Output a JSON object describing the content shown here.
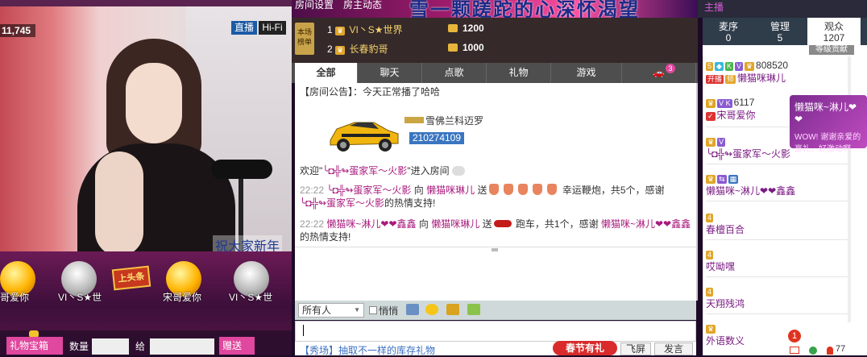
{
  "stream": {
    "viewer_count": "11,745",
    "btn_live": "直播",
    "btn_hifi": "Hi-Fi",
    "overlay_text": "祝大家新年"
  },
  "gift_row": {
    "items": [
      {
        "label": "哥爱你",
        "style": "gold"
      },
      {
        "label": "VI丶S★世",
        "style": "gray"
      },
      {
        "label": "宋哥爱你",
        "style": "gold"
      },
      {
        "label": "VI丶S★世",
        "style": "gray"
      }
    ],
    "headline_badge": "上头条"
  },
  "gift_bar": {
    "gift_box_label": "礼物宝箱",
    "qty_label": "数量",
    "give_label": "给",
    "send_label": "赠送"
  },
  "mid_top": {
    "links": [
      "房间设置",
      "房主动态"
    ],
    "banner": "雪一颗蹉跎的心深怀渴望"
  },
  "rank": {
    "badge": "本场榜单",
    "rows": [
      {
        "pos": "1",
        "name": "VI丶S★世界",
        "coins": "1200"
      },
      {
        "pos": "2",
        "name": "长春豹哥",
        "coins": "1000"
      }
    ]
  },
  "tabs": [
    {
      "label": "全部",
      "active": true
    },
    {
      "label": "聊天"
    },
    {
      "label": "点歌"
    },
    {
      "label": "礼物"
    },
    {
      "label": "游戏"
    }
  ],
  "car_badge_count": "3",
  "chat": {
    "notice_label": "【房间公告】：",
    "notice_text": "今天正常播了哈哈",
    "car_name": "雪佛兰科迈罗",
    "car_id": "210274109",
    "welcome_pre": "欢迎",
    "welcome_user": "╰◘╬↬蛋家军～火影",
    "welcome_post": "进入房间",
    "msg1": {
      "time": "22:22",
      "from": "╰◘╬↬蛋家军～火影",
      "to_word": "向",
      "to": "懒猫咪琳儿",
      "send": "送",
      "gift_text": "幸运鞭炮，共5个，感谢",
      "thank_user": "╰◘╬↬蛋家军～火影",
      "tail": "的热情支持!"
    },
    "msg2": {
      "time": "22:22",
      "from": "懒猫咪~淋儿❤❤鑫鑫",
      "to_word": "向",
      "to": "懒猫咪琳儿",
      "send": "送",
      "gift_text": "跑车，共1个，感谢",
      "thank_user": "懒猫咪~淋儿❤❤鑫鑫",
      "tail": "的热情支持!"
    }
  },
  "toolbar": {
    "recipient": "所有人",
    "quiet_label": "悄悄"
  },
  "promo": {
    "text": "【秀场】抽取不一样的库存礼物",
    "spring_btn": "春节有礼",
    "fly_btn": "飞屏",
    "send_btn": "发言"
  },
  "right": {
    "top_text": "主播",
    "tabs": [
      {
        "label": "麦序",
        "count": "0"
      },
      {
        "label": "管理",
        "count": "5"
      },
      {
        "label": "观众",
        "count": "1207",
        "active": true
      }
    ],
    "header_label": "等级贡献",
    "users": [
      {
        "badges": "5",
        "score": "808520",
        "name": "懒猫咪琳儿"
      },
      {
        "badges": "V K",
        "score": "6117",
        "name": "宋哥爱你"
      },
      {
        "badges": "V",
        "name": "╰◘╬↬蛋家军～火影"
      },
      {
        "badges": "",
        "name": "懒猫咪~淋儿❤❤鑫鑫"
      },
      {
        "badges": "4",
        "name": "春檀百合"
      },
      {
        "badges": "4",
        "name": "哎呦嘿"
      },
      {
        "badges": "4",
        "name": "天翔残鸿"
      },
      {
        "badges": "",
        "name": "外语数义"
      }
    ],
    "popup_title": "懒猫咪~淋儿❤❤",
    "popup_sub": "WOW! 谢谢亲爱的豪礼，好激动啊"
  },
  "footer": {
    "notif_count": "1",
    "user_count": "77"
  },
  "colors": {
    "accent_pink": "#e0479e",
    "name_purple": "#7a1a83",
    "chat_pink": "#a81a7d"
  }
}
